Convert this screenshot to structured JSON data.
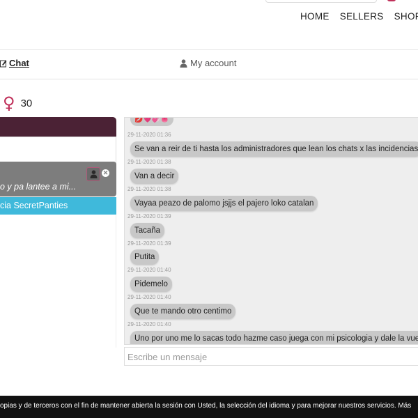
{
  "nav": {
    "home": "HOME",
    "sellers": "SELLERS",
    "shop": "SHOP"
  },
  "tabs": {
    "chat": "Chat",
    "account": "My account"
  },
  "profile": {
    "age": "30"
  },
  "contacts": {
    "preview": "o y pa lantee a mi...",
    "agency": "cia SecretPanties"
  },
  "chat": {
    "emoji_text": "💋💗💞👅",
    "messages": [
      {
        "text": "",
        "time": "29-11-2020 01:36"
      },
      {
        "text": "Se van a reir de ti hasta los administradores que lean los chats x las incidencias",
        "time": "29-11-2020 01:38"
      },
      {
        "text": "Van a decir",
        "time": "29-11-2020 01:38"
      },
      {
        "text": "Vayaa peazo de palomo jsjjs el pajero loko catalan",
        "time": "29-11-2020 01:39"
      },
      {
        "text": "Tacaña",
        "time": "29-11-2020 01:39"
      },
      {
        "text": "Putita",
        "time": "29-11-2020 01:40"
      },
      {
        "text": "Pidemelo",
        "time": "29-11-2020 01:40"
      },
      {
        "text": "Que te mando otro centimo",
        "time": "29-11-2020 01:40"
      },
      {
        "text": "Uno por uno me lo sacas todo hazme caso juega con mi psicologia y dale la vuelta a",
        "time": ""
      }
    ],
    "placeholder": "Escribe un mensaje"
  },
  "cookie": {
    "text": "opias y de terceros con el fin de mantener abierta la sesión con Usted, la selección del idioma y para mejorar nuestros servicios. Más"
  },
  "colors": {
    "brand": "#4b2235",
    "accent": "#c0305a",
    "agency": "#3fb9db"
  },
  "icons": [
    "edit-icon",
    "user-icon",
    "female-icon",
    "close-icon"
  ]
}
